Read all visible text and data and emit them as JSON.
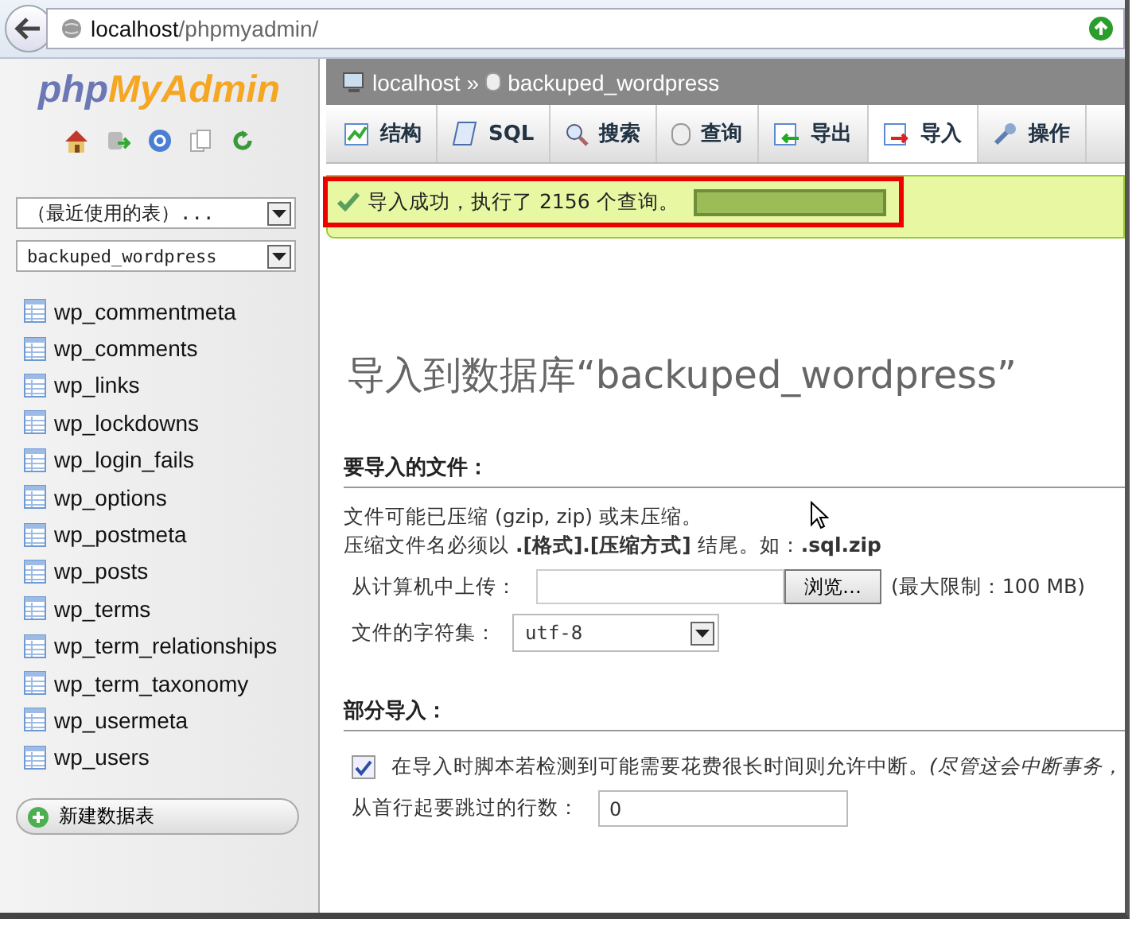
{
  "browser": {
    "url_host": "localhost",
    "url_path": "/phpmyadmin/"
  },
  "sidebar": {
    "logo_php": "php",
    "logo_rest": "MyAdmin",
    "recent_select": "（最近使用的表）...",
    "db_select": "backuped_wordpress",
    "tables": [
      {
        "name": "wp_commentmeta"
      },
      {
        "name": "wp_comments"
      },
      {
        "name": "wp_links"
      },
      {
        "name": "wp_lockdowns"
      },
      {
        "name": "wp_login_fails"
      },
      {
        "name": "wp_options"
      },
      {
        "name": "wp_postmeta"
      },
      {
        "name": "wp_posts"
      },
      {
        "name": "wp_terms"
      },
      {
        "name": "wp_term_relationships"
      },
      {
        "name": "wp_term_taxonomy"
      },
      {
        "name": "wp_usermeta"
      },
      {
        "name": "wp_users"
      }
    ],
    "new_table_button": "新建数据表"
  },
  "breadcrumb": {
    "server": "localhost",
    "separator": "»",
    "database": "backuped_wordpress"
  },
  "tabs": [
    {
      "label": "结构",
      "kind": "structure",
      "selected": false
    },
    {
      "label": "SQL",
      "kind": "sql",
      "selected": false
    },
    {
      "label": "搜索",
      "kind": "search",
      "selected": false
    },
    {
      "label": "查询",
      "kind": "query",
      "selected": false
    },
    {
      "label": "导出",
      "kind": "export",
      "selected": false
    },
    {
      "label": "导入",
      "kind": "import",
      "selected": true
    },
    {
      "label": "操作",
      "kind": "operations",
      "selected": false
    }
  ],
  "message": {
    "text": "导入成功，执行了 2156 个查询。"
  },
  "heading": "导入到数据库“backuped_wordpress”",
  "file_section": {
    "title": "要导入的文件：",
    "note_1": "文件可能已压缩 (gzip, zip) 或未压缩。",
    "note_2": "压缩文件名必须以 **.[格式].[压缩方式]** 结尾。如：**.sql.zip**",
    "upload_label": "从计算机中上传：",
    "browse_button": "浏览…",
    "limit": "(最大限制：100 MB)",
    "charset_label": "文件的字符集：",
    "charset_value": "utf-8"
  },
  "partial_section": {
    "title": "部分导入：",
    "interrupt_checked": true,
    "interrupt_label": "在导入时脚本若检测到可能需要花费很长时间则允许中断。*(尽管这会中断事务，*",
    "skip_label": "从首行起要跳过的行数：",
    "skip_value": "0"
  }
}
